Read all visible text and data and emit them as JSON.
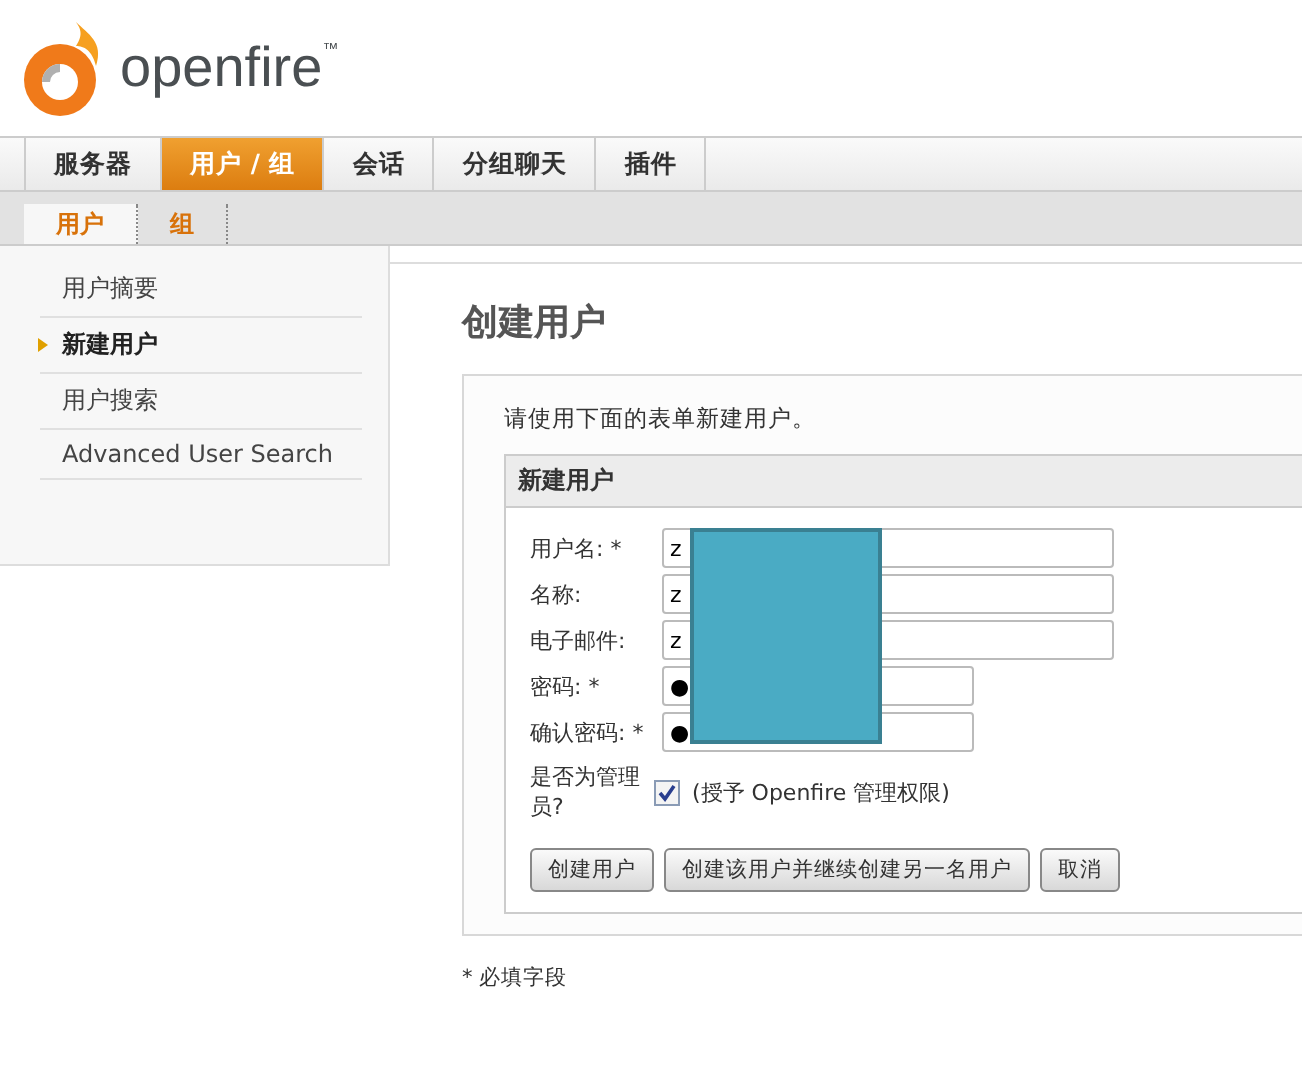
{
  "logo": {
    "name": "openfire",
    "trademark": "™"
  },
  "nav_tabs": [
    {
      "label": "服务器",
      "selected": false
    },
    {
      "label": "用户 / 组",
      "selected": true
    },
    {
      "label": "会话",
      "selected": false
    },
    {
      "label": "分组聊天",
      "selected": false
    },
    {
      "label": "插件",
      "selected": false
    }
  ],
  "sub_tabs": [
    {
      "label": "用户",
      "selected": true
    },
    {
      "label": "组",
      "selected": false
    }
  ],
  "sidebar": {
    "items": [
      {
        "label": "用户摘要",
        "selected": false
      },
      {
        "label": "新建用户",
        "selected": true
      },
      {
        "label": "用户搜索",
        "selected": false
      },
      {
        "label": "Advanced User Search",
        "selected": false
      }
    ]
  },
  "page_title": "创建用户",
  "form": {
    "intro": "请使用下面的表单新建用户。",
    "panel_title": "新建用户",
    "fields": [
      {
        "label": "用户名: *",
        "value": "z",
        "kind": "text"
      },
      {
        "label": "名称:",
        "value": "z",
        "kind": "text"
      },
      {
        "label": "电子邮件:",
        "value": "z",
        "kind": "text"
      },
      {
        "label": "密码: *",
        "value": "●",
        "kind": "password"
      },
      {
        "label": "确认密码: *",
        "value": "●",
        "kind": "password"
      }
    ],
    "admin": {
      "label": "是否为管理员?",
      "checked": true,
      "option": "(授予 Openfire 管理权限)"
    },
    "buttons": [
      "创建用户",
      "创建该用户并继续创建另一名用户",
      "取消"
    ],
    "footnote": "* 必填字段"
  }
}
